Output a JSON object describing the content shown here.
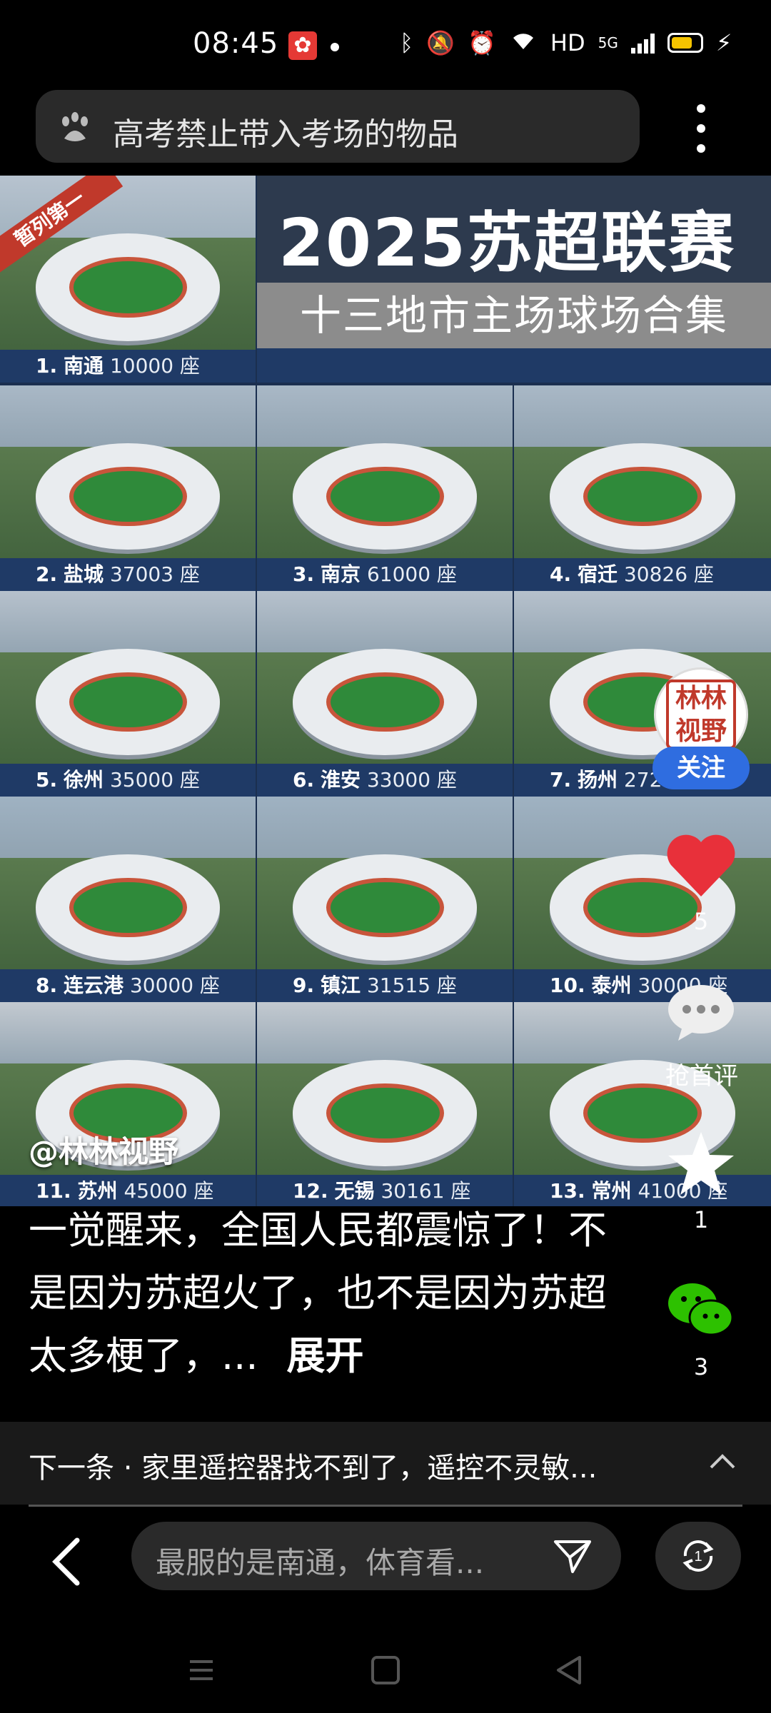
{
  "status_bar": {
    "time": "08:45",
    "network_label": "HD",
    "network_type": "5G",
    "app_icon": "flower-badge-icon",
    "battery_color": "#f5c400"
  },
  "search": {
    "query": "高考禁止带入考场的物品",
    "icon": "baidu-paw-icon"
  },
  "poster": {
    "ribbon": "暂列第一",
    "title": "2025苏超联赛",
    "subtitle": "十三地市主场球场合集",
    "watermark": "@林林视野",
    "stadiums": [
      {
        "rank": "1.",
        "city": "南通",
        "seats": "10000 座"
      },
      {
        "rank": "2.",
        "city": "盐城",
        "seats": "37003 座"
      },
      {
        "rank": "3.",
        "city": "南京",
        "seats": "61000 座"
      },
      {
        "rank": "4.",
        "city": "宿迁",
        "seats": "30826 座"
      },
      {
        "rank": "5.",
        "city": "徐州",
        "seats": "35000 座"
      },
      {
        "rank": "6.",
        "city": "淮安",
        "seats": "33000 座"
      },
      {
        "rank": "7.",
        "city": "扬州",
        "seats": "272"
      },
      {
        "rank": "8.",
        "city": "连云港",
        "seats": "30000 座"
      },
      {
        "rank": "9.",
        "city": "镇江",
        "seats": "31515 座"
      },
      {
        "rank": "10.",
        "city": "泰州",
        "seats": "30000 座"
      },
      {
        "rank": "11.",
        "city": "苏州",
        "seats": "45000 座"
      },
      {
        "rank": "12.",
        "city": "无锡",
        "seats": "30161 座"
      },
      {
        "rank": "13.",
        "city": "常州",
        "seats": "41000 座"
      }
    ]
  },
  "author": {
    "seal_text": "林林视野",
    "follow_label": "关注"
  },
  "actions": {
    "likes": "5",
    "comment_label": "抢首评",
    "favorites": "1",
    "shares": "3"
  },
  "description": {
    "text": "一觉醒来，全国人民都震惊了！不是因为苏超火了，也不是因为苏超太多梗了，...",
    "expand_label": "展开"
  },
  "next": {
    "text": "下一条 · 家里遥控器找不到了，遥控不灵敏..."
  },
  "comment_bar": {
    "placeholder": "最服的是南通，体育看..."
  },
  "colors": {
    "caption_bg": "#1f3a66",
    "follow_button": "#2f6de0",
    "heart": "#e8303a"
  }
}
